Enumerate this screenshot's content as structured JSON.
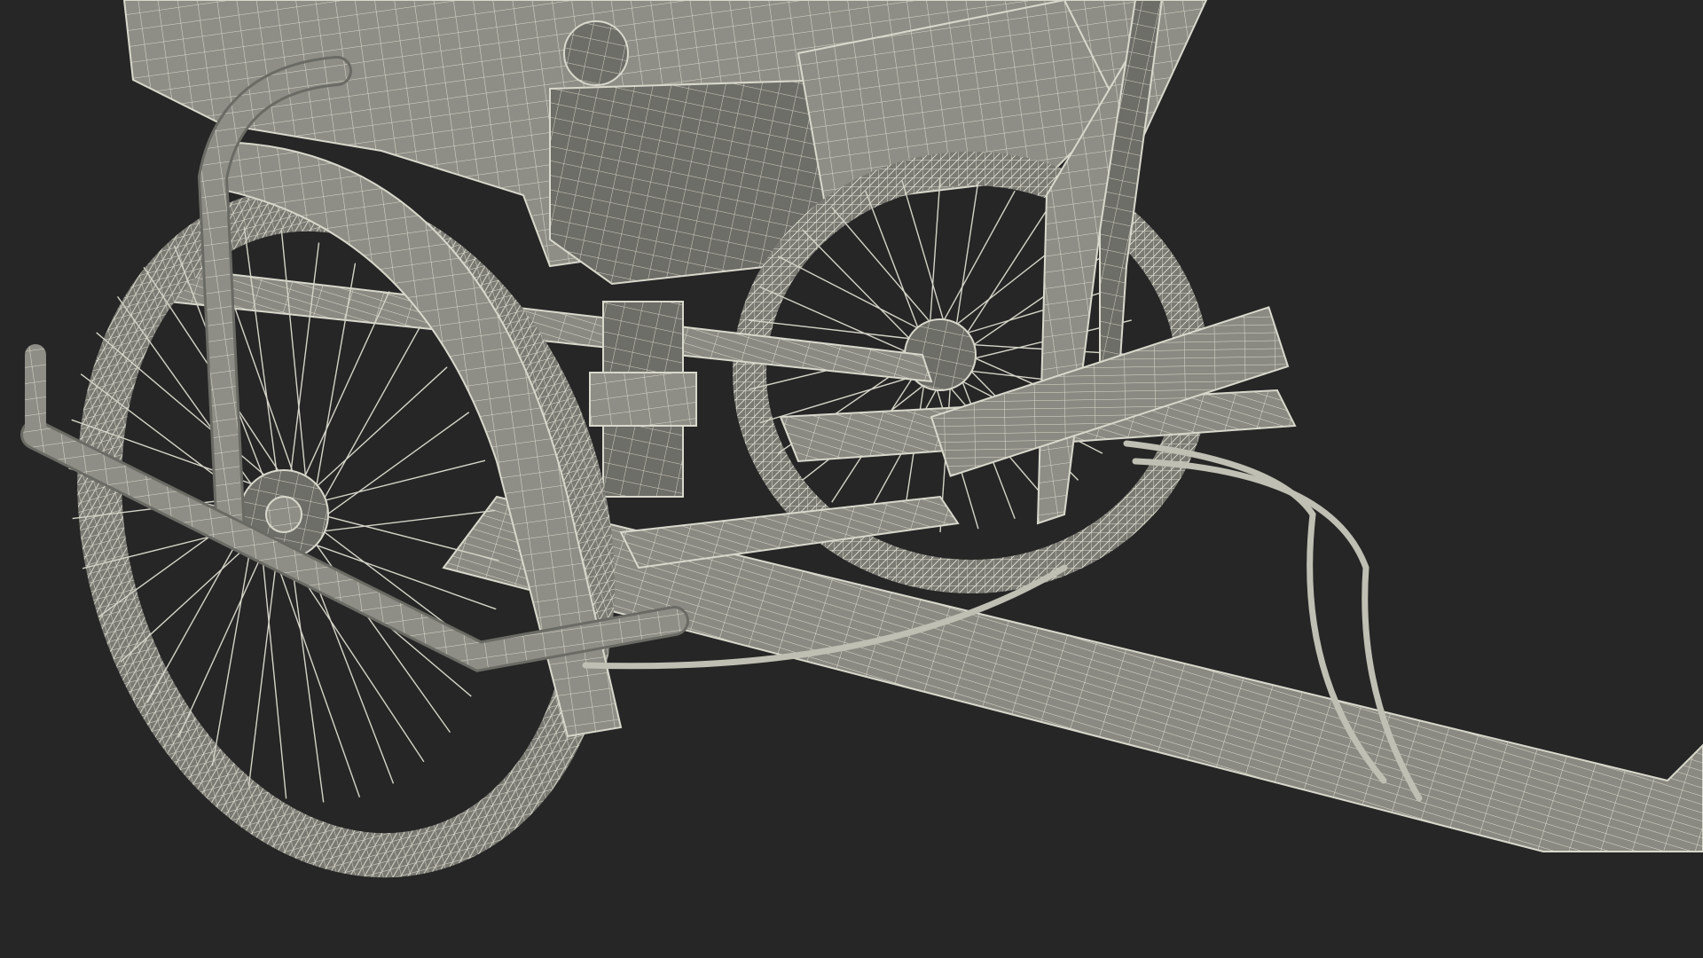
{
  "scene": {
    "subject": "wireframe-render",
    "background_color": "#262626",
    "surface_color": "#8e8e86",
    "surface_dark": "#5f5f59",
    "wire_color": "#d8d8cc"
  }
}
